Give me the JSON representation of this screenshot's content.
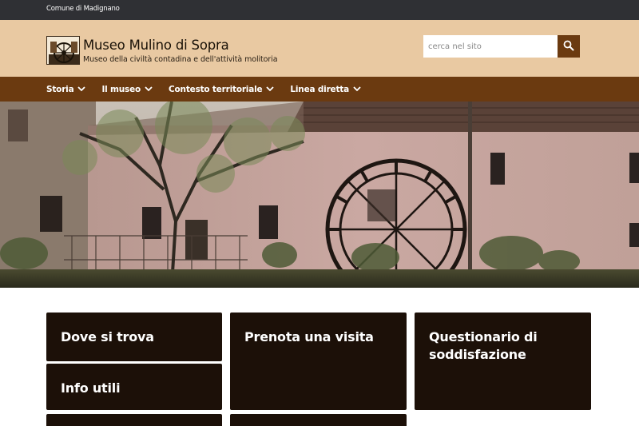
{
  "topbar": {
    "link": "Comune di Madignano"
  },
  "header": {
    "title": "Museo Mulino di Sopra",
    "subtitle": "Museo della civiltà contadina e dell'attività molitoria",
    "logo_icon": "mill-wheel-logo",
    "search": {
      "placeholder": "cerca nel sito",
      "icon": "search-icon"
    }
  },
  "nav": {
    "items": [
      {
        "label": "Storia"
      },
      {
        "label": "Il museo"
      },
      {
        "label": "Contesto territoriale"
      },
      {
        "label": "Linea diretta"
      }
    ]
  },
  "cards": [
    {
      "label": "Dove si trova"
    },
    {
      "label": "Prenota una visita"
    },
    {
      "label": "Questionario di soddisfazione"
    },
    {
      "label": "Info utili"
    },
    {
      "label": ""
    },
    {
      "label": ""
    }
  ],
  "colors": {
    "topbar": "#2f3034",
    "header": "#e9c9a2",
    "nav": "#6b3a10",
    "card": "#1c1008"
  }
}
